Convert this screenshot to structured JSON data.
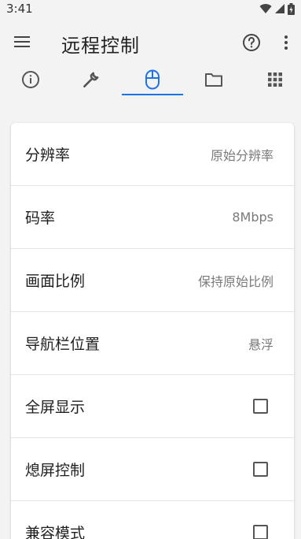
{
  "status_bar": {
    "time": "3:41"
  },
  "app_bar": {
    "title": "远程控制"
  },
  "settings": {
    "resolution": {
      "label": "分辨率",
      "value": "原始分辨率"
    },
    "bitrate": {
      "label": "码率",
      "value": "8Mbps"
    },
    "aspect_ratio": {
      "label": "画面比例",
      "value": "保持原始比例"
    },
    "nav_bar_position": {
      "label": "导航栏位置",
      "value": "悬浮"
    },
    "fullscreen": {
      "label": "全屏显示",
      "checked": false
    },
    "screen_off_control": {
      "label": "熄屏控制",
      "checked": false
    },
    "compat_mode": {
      "label": "兼容模式",
      "checked": false
    }
  },
  "colors": {
    "accent": "#1a73e8",
    "icon": "#555555",
    "background": "#f3f3f3"
  },
  "tabs": [
    {
      "icon": "info-icon"
    },
    {
      "icon": "wrench-icon"
    },
    {
      "icon": "mouse-icon",
      "selected": true
    },
    {
      "icon": "folder-icon"
    },
    {
      "icon": "apps-grid-icon"
    }
  ]
}
